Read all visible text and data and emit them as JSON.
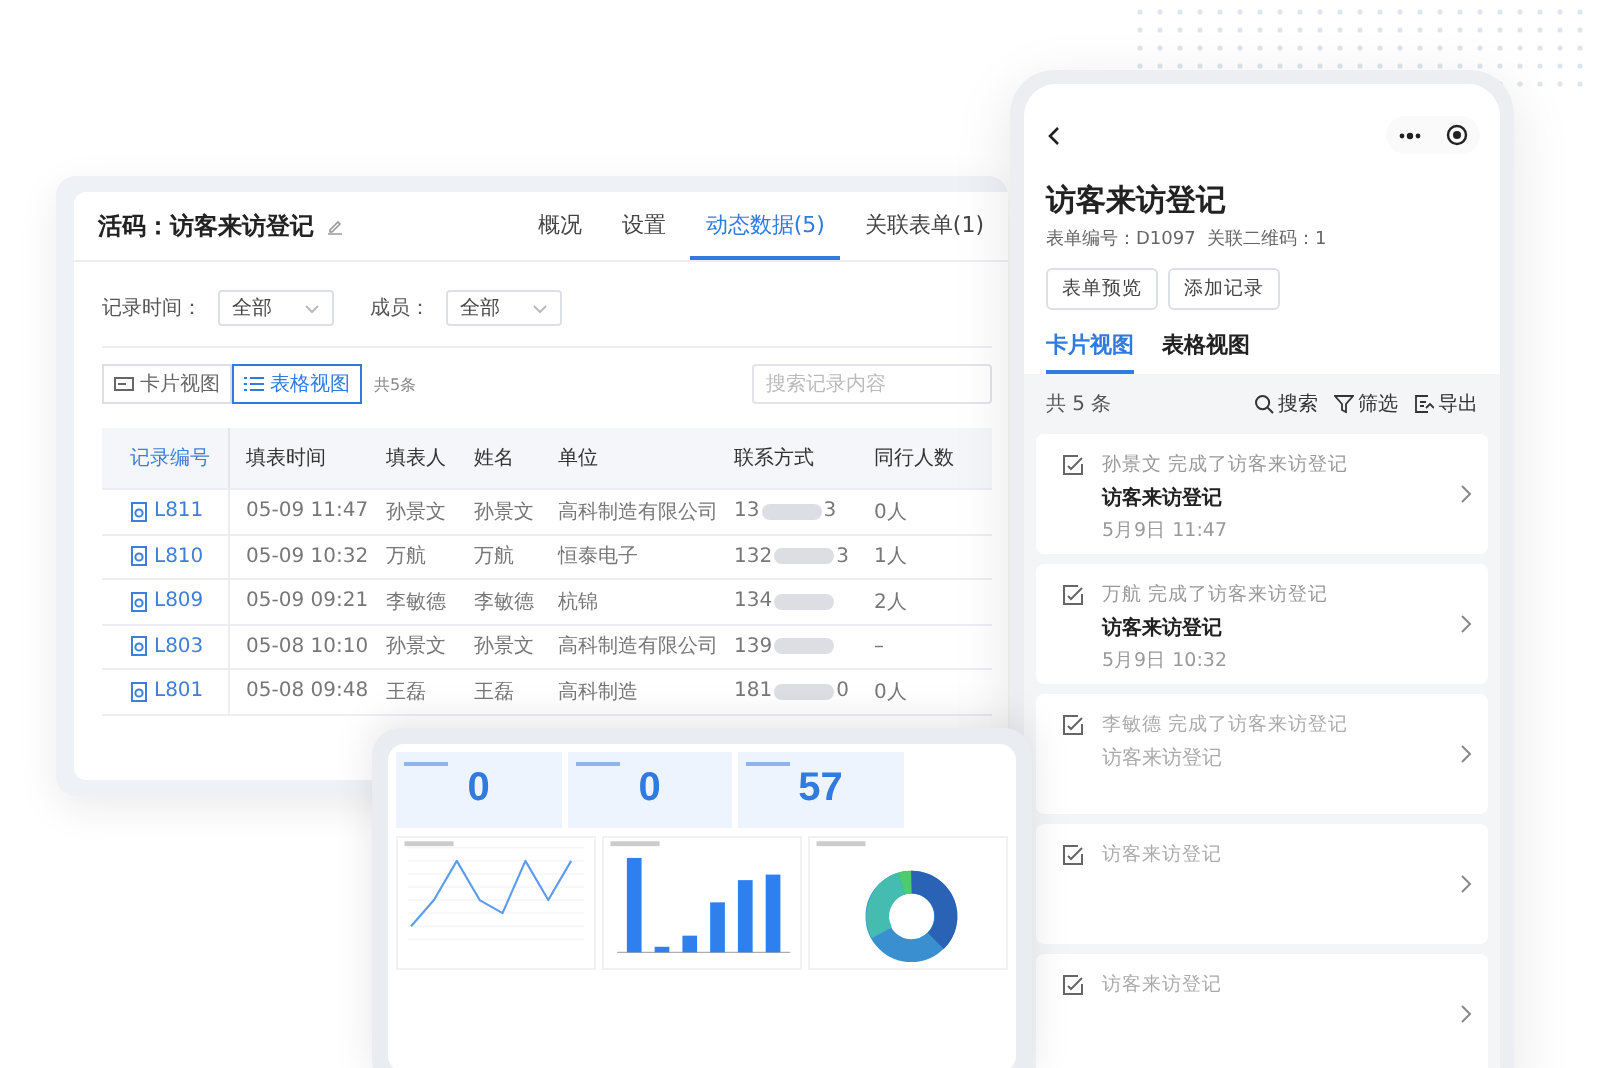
{
  "desktop": {
    "title": "活码：访客来访登记",
    "tabs": [
      {
        "label": "概况",
        "selected": false
      },
      {
        "label": "设置",
        "selected": false
      },
      {
        "label": "动态数据(5)",
        "selected": true
      },
      {
        "label": "关联表单(1)",
        "selected": false
      }
    ],
    "filters": [
      {
        "label": "记录时间：",
        "value": "全部"
      },
      {
        "label": "成员：",
        "value": "全部"
      }
    ],
    "views": [
      {
        "label": "卡片视图",
        "kind": "card",
        "selected": false
      },
      {
        "label": "表格视图",
        "kind": "table",
        "selected": true
      }
    ],
    "count": "共5条",
    "search": {
      "placeholder": "搜索记录内容"
    },
    "table": {
      "columns": [
        "记录编号",
        "填表时间",
        "填表人",
        "姓名",
        "单位",
        "联系方式",
        "同行人数"
      ],
      "rows": [
        {
          "id": "L811",
          "time": "05-09 11:47",
          "filler": "孙景文",
          "name": "孙景文",
          "unit": "高科制造有限公司",
          "phone_start": "13",
          "phone_end": "3",
          "companions": "0人"
        },
        {
          "id": "L810",
          "time": "05-09 10:32",
          "filler": "万航",
          "name": "万航",
          "unit": "恒泰电子",
          "phone_start": "132",
          "phone_end": "3",
          "companions": "1人"
        },
        {
          "id": "L809",
          "time": "05-09 09:21",
          "filler": "李敏德",
          "name": "李敏德",
          "unit": "杭锦",
          "phone_start": "134",
          "companions": "2人"
        },
        {
          "id": "L803",
          "time": "05-08 10:10",
          "filler": "孙景文",
          "name": "孙景文",
          "unit": "高科制造有限公司",
          "phone_start": "139",
          "companions": "–"
        },
        {
          "id": "L801",
          "time": "05-08 09:48",
          "filler": "王磊",
          "name": "王磊",
          "unit": "高科制造",
          "phone_start": "181",
          "phone_end": "0",
          "companions": "0人"
        }
      ]
    }
  },
  "mobile": {
    "title": "访客来访登记",
    "meta": "表单编号：D1097  关联二维码：1",
    "buttons": [
      "表单预览",
      "添加记录"
    ],
    "tabs": [
      {
        "label": "卡片视图",
        "selected": true
      },
      {
        "label": "表格视图",
        "selected": false
      }
    ],
    "count": "共 5 条",
    "actions": [
      {
        "label": "搜索",
        "kind": "search"
      },
      {
        "label": "筛选",
        "kind": "filter"
      },
      {
        "label": "导出",
        "kind": "export"
      }
    ],
    "cards": [
      {
        "summary": "孙景文 完成了访客来访登记",
        "title": "访客来访登记",
        "date": "5月9日 11:47",
        "faded": false
      },
      {
        "summary": "万航 完成了访客来访登记",
        "title": "访客来访登记",
        "date": "5月9日 10:32",
        "faded": false
      },
      {
        "summary": "李敏德 完成了访客来访登记",
        "title": "访客来访登记",
        "faded": true
      },
      {
        "summary": "访客来访登记",
        "faded": true
      },
      {
        "summary": "访客来访登记",
        "faded": true
      }
    ]
  },
  "dashboard": {
    "stats": [
      {
        "value": "0"
      },
      {
        "value": "0"
      },
      {
        "value": "57"
      }
    ]
  }
}
